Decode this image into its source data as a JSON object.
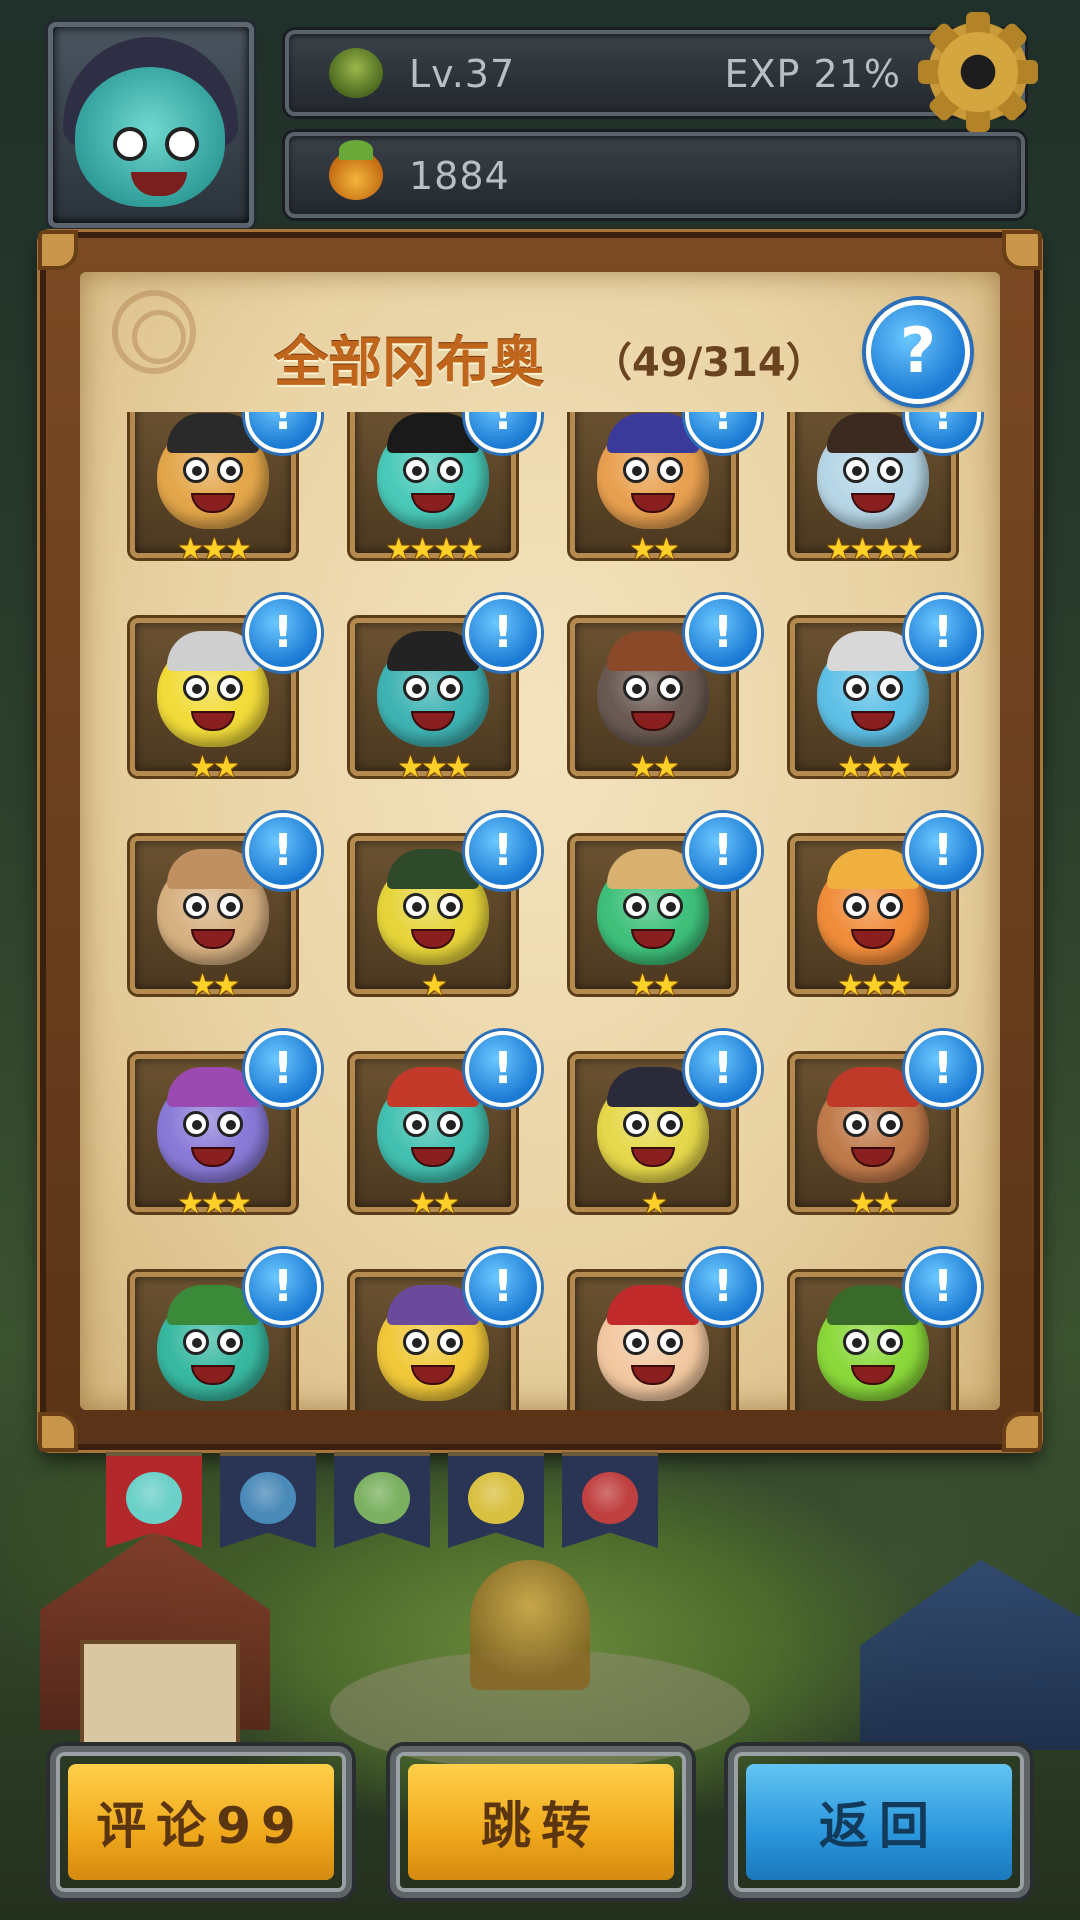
{
  "hud": {
    "level": "Lv.37",
    "exp": "EXP  21%",
    "fruit_count": "1884"
  },
  "panel": {
    "title": "全部冈布奥",
    "count": "（49/314）",
    "help_label": "?"
  },
  "cards": [
    {
      "stars": "★★★",
      "body": "#e3a64a",
      "hat": "#2a2a2a",
      "badge": "!"
    },
    {
      "stars": "★★★★",
      "body": "#49c9b8",
      "hat": "#1a1a1a",
      "badge": "!"
    },
    {
      "stars": "★★",
      "body": "#e8a050",
      "hat": "#3a3a9a",
      "badge": "!"
    },
    {
      "stars": "★★★★",
      "body": "#b6d6e6",
      "hat": "#3a2a20",
      "badge": "!"
    },
    {
      "stars": "★★",
      "body": "#f2dc3a",
      "hat": "#cfcfcf",
      "badge": "!"
    },
    {
      "stars": "★★★",
      "body": "#3fb3b3",
      "hat": "#232323",
      "badge": "!"
    },
    {
      "stars": "★★",
      "body": "#6a5a52",
      "hat": "#8a4a2a",
      "badge": "!"
    },
    {
      "stars": "★★★",
      "body": "#5ec0e6",
      "hat": "#d8d8d8",
      "badge": "!"
    },
    {
      "stars": "★★",
      "body": "#d6b080",
      "hat": "#c09060",
      "badge": "!"
    },
    {
      "stars": "★",
      "body": "#e6d43a",
      "hat": "#2f4a2a",
      "badge": "!"
    },
    {
      "stars": "★★",
      "body": "#3ec07a",
      "hat": "#d8b070",
      "badge": "!"
    },
    {
      "stars": "★★★",
      "body": "#f08c3a",
      "hat": "#f0b040",
      "badge": "!"
    },
    {
      "stars": "★★★",
      "body": "#8a7ad8",
      "hat": "#9a4ab0",
      "badge": "!"
    },
    {
      "stars": "★★",
      "body": "#42c0b0",
      "hat": "#c43a2a",
      "badge": "!"
    },
    {
      "stars": "★",
      "body": "#e6d84a",
      "hat": "#2a2a3a",
      "badge": "!"
    },
    {
      "stars": "★★",
      "body": "#c07a4a",
      "hat": "#c03a2a",
      "badge": "!"
    },
    {
      "stars": "",
      "body": "#38b8a0",
      "hat": "#3a8a3a",
      "badge": "!"
    },
    {
      "stars": "",
      "body": "#f0c83a",
      "hat": "#6a4a9a",
      "badge": "!"
    },
    {
      "stars": "",
      "body": "#f2c8a0",
      "hat": "#c02a2a",
      "badge": "!"
    },
    {
      "stars": "",
      "body": "#8ad83a",
      "hat": "#3a6a2a",
      "badge": "!"
    }
  ],
  "tabs": [
    {
      "name": "all",
      "active": true,
      "color": "#6ad0c8"
    },
    {
      "name": "blue",
      "active": false,
      "color": "#4a8ab8"
    },
    {
      "name": "green",
      "active": false,
      "color": "#7ab060"
    },
    {
      "name": "yellow",
      "active": false,
      "color": "#d8c040"
    },
    {
      "name": "red",
      "active": false,
      "color": "#c04040"
    }
  ],
  "buttons": {
    "comment": "评论99",
    "jump": "跳转",
    "back": "返回"
  },
  "icons": {
    "level": "tree-icon",
    "currency": "fruit-icon",
    "settings": "gear-icon",
    "help": "question-icon",
    "card_badge": "exclamation-icon"
  }
}
